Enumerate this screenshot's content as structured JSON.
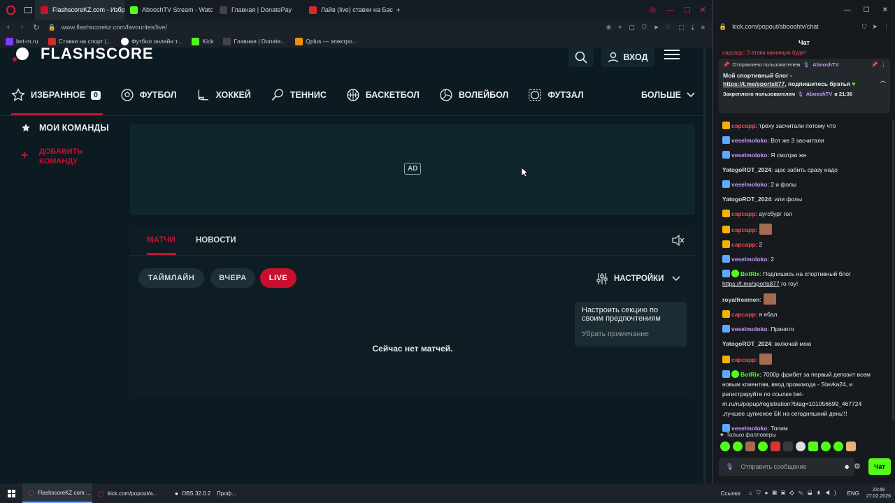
{
  "browser": {
    "tabs": [
      {
        "label": "FlashscoreKZ.com - Избр",
        "color": "#c8102e"
      },
      {
        "label": "AbooshTV Stream - Watc",
        "color": "#53fc18"
      },
      {
        "label": "Главная | DonatePay",
        "color": "#2b2b2b"
      },
      {
        "label": "Лайв (live) ставки на Бас",
        "color": "#d62a2a"
      }
    ],
    "address": "www.flashscorekz.com/favourites/live/",
    "bookmarks": [
      {
        "label": "bet-m.ru",
        "color": "#7d3cff"
      },
      {
        "label": "Ставки на спорт |...",
        "color": "#d62a2a"
      },
      {
        "label": "Футбол онлайн т...",
        "color": "#ffffff"
      },
      {
        "label": "Kick",
        "color": "#53fc18"
      },
      {
        "label": "Главная | Donate...",
        "color": "#2b2b2b"
      },
      {
        "label": "Qplus — электро...",
        "color": "#f29100"
      }
    ]
  },
  "site": {
    "logo": "FLASHSCORE",
    "login": "ВХОД",
    "nav": {
      "favorites": "ИЗБРАННОЕ",
      "favorites_count": "0",
      "football": "ФУТБОЛ",
      "hockey": "ХОККЕЙ",
      "tennis": "ТЕННИС",
      "basketball": "БАСКЕТБОЛ",
      "volleyball": "ВОЛЕЙБОЛ",
      "futsal": "ФУТЗАЛ",
      "more": "БОЛЬШЕ"
    },
    "sidebar": {
      "my_teams": "МОИ КОМАНДЫ",
      "add_team_1": "ДОБАВИТЬ",
      "add_team_2": "КОМАНДУ"
    },
    "ad_label": "AD",
    "tabs": {
      "matches": "МАТЧИ",
      "news": "НОВОСТИ"
    },
    "filters": {
      "timeline": "ТАЙМЛАЙН",
      "yesterday": "ВЧЕРА",
      "live": "LIVE",
      "settings": "НАСТРОЙКИ"
    },
    "tooltip": {
      "text_1": "Настроить секцию по",
      "text_2": "своим предпочтениям",
      "dismiss": "Убрать примечание"
    },
    "empty_text": "Сейчас нет матчей."
  },
  "chat": {
    "address": "kick.com/popout/abooshtv/chat",
    "title": "Чат",
    "top_partial": "сарсарр: 3 атаки минимум будет",
    "pinned": {
      "by_label": "Отправлено пользователем",
      "author": "AbooshTV",
      "text": "Мой спортивный блог -",
      "link": "https://t.me/sports877",
      "text_after": ", подпишитесь братья",
      "pinned_by": "Закреплено пользователем",
      "pinned_time": "в 21:36"
    },
    "colors": {
      "yellow": "#f2b000",
      "blue": "#5ca9ff",
      "green": "#53fc18",
      "red": "#ef4a57",
      "violet": "#c59bff"
    },
    "messages": [
      {
        "user": "сарсарр",
        "text": ": трёху засчитали потому что",
        "color": "#ef4a57",
        "badge": "crown"
      },
      {
        "user": "veselmoloko",
        "text": ": Вот же 3 засчитали",
        "color": "#c59bff",
        "badge": "arrow"
      },
      {
        "user": "veselmoloko",
        "text": ": Я смотрю же",
        "color": "#c59bff",
        "badge": "arrow"
      },
      {
        "user": "YatogoROT_2024",
        "text": ": щас забить сразу надо",
        "color": "#d7dadc",
        "badge": ""
      },
      {
        "user": "veselmoloko",
        "text": ": 2 и фолы",
        "color": "#c59bff",
        "badge": "arrow"
      },
      {
        "user": "YatogoROT_2024",
        "text": ": или фолы",
        "color": "#d7dadc",
        "badge": ""
      },
      {
        "user": "сарсарр",
        "text": ": аугсбург гол",
        "color": "#ef4a57",
        "badge": "crown"
      },
      {
        "user": "сарсарр",
        "text": ":",
        "color": "#ef4a57",
        "badge": "crown",
        "emote": true
      },
      {
        "user": "сарсарр",
        "text": ": 2",
        "color": "#ef4a57",
        "badge": "crown"
      },
      {
        "user": "veselmoloko",
        "text": ": 2",
        "color": "#c59bff",
        "badge": "arrow"
      }
    ],
    "botrix1": {
      "user": "BotRix",
      "text": ": Подпишись на спортивный блог",
      "link": "https://t.me/sports877",
      "text2": " го гоу!"
    },
    "messages2": [
      {
        "user": "royalfreemen",
        "text": ":",
        "color": "#d7dadc",
        "badge": "",
        "emote": true
      },
      {
        "user": "сарсарр",
        "text": ": я ебал",
        "color": "#ef4a57",
        "badge": "crown"
      },
      {
        "user": "veselmoloko",
        "text": ": Принято",
        "color": "#c59bff",
        "badge": "arrow"
      },
      {
        "user": "YatogoROT_2024",
        "text": ": включай мою",
        "color": "#d7dadc",
        "badge": ""
      },
      {
        "user": "сарсарр",
        "text": ":",
        "color": "#ef4a57",
        "badge": "crown",
        "emote": true
      }
    ],
    "botrix2": {
      "user": "BotRix",
      "line1": ": 7000р фрибет за первый депозит всем",
      "line2": "новым клиентам, ввод промокода - Stavka24, и",
      "line3": "регистрируйте по ссылке bet-",
      "line4": "m.ru/ru/popup/registration?btag=101056699_467724",
      "line5": ",лучшее цуписное БК на сегодняшний день!!!"
    },
    "last": {
      "user": "veselmoloko",
      "text": ": Топим"
    },
    "followers_only": "Только фолловеры",
    "input_placeholder": "Отправить сообщение",
    "send": "Чат"
  },
  "taskbar": {
    "items": [
      "FlashscoreKZ.com ...",
      "kick.com/popout/a...",
      "OBS 32.0.2",
      "Проф..."
    ],
    "links": "Ссылки",
    "lang": "ENG",
    "time": "23:48",
    "date": "27.02.2026"
  }
}
